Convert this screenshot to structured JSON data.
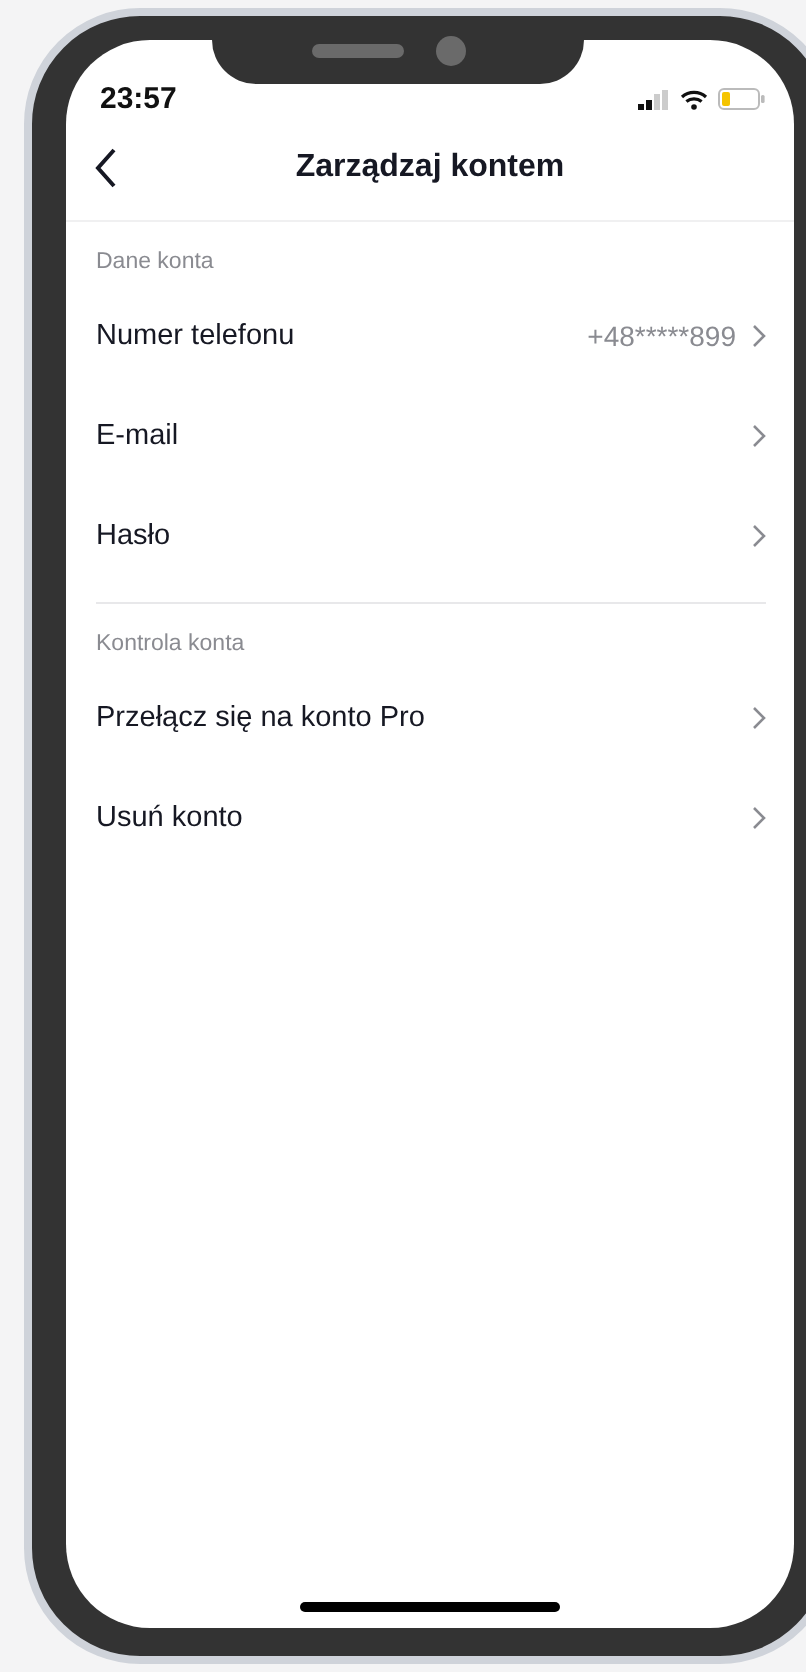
{
  "status_bar": {
    "time": "23:57"
  },
  "header": {
    "title": "Zarządzaj kontem"
  },
  "sections": [
    {
      "title": "Dane konta",
      "items": [
        {
          "label": "Numer telefonu",
          "value": "+48*****899"
        },
        {
          "label": "E-mail"
        },
        {
          "label": "Hasło"
        }
      ]
    },
    {
      "title": "Kontrola konta",
      "items": [
        {
          "label": "Przełącz się na konto Pro"
        },
        {
          "label": "Usuń konto"
        }
      ]
    }
  ]
}
